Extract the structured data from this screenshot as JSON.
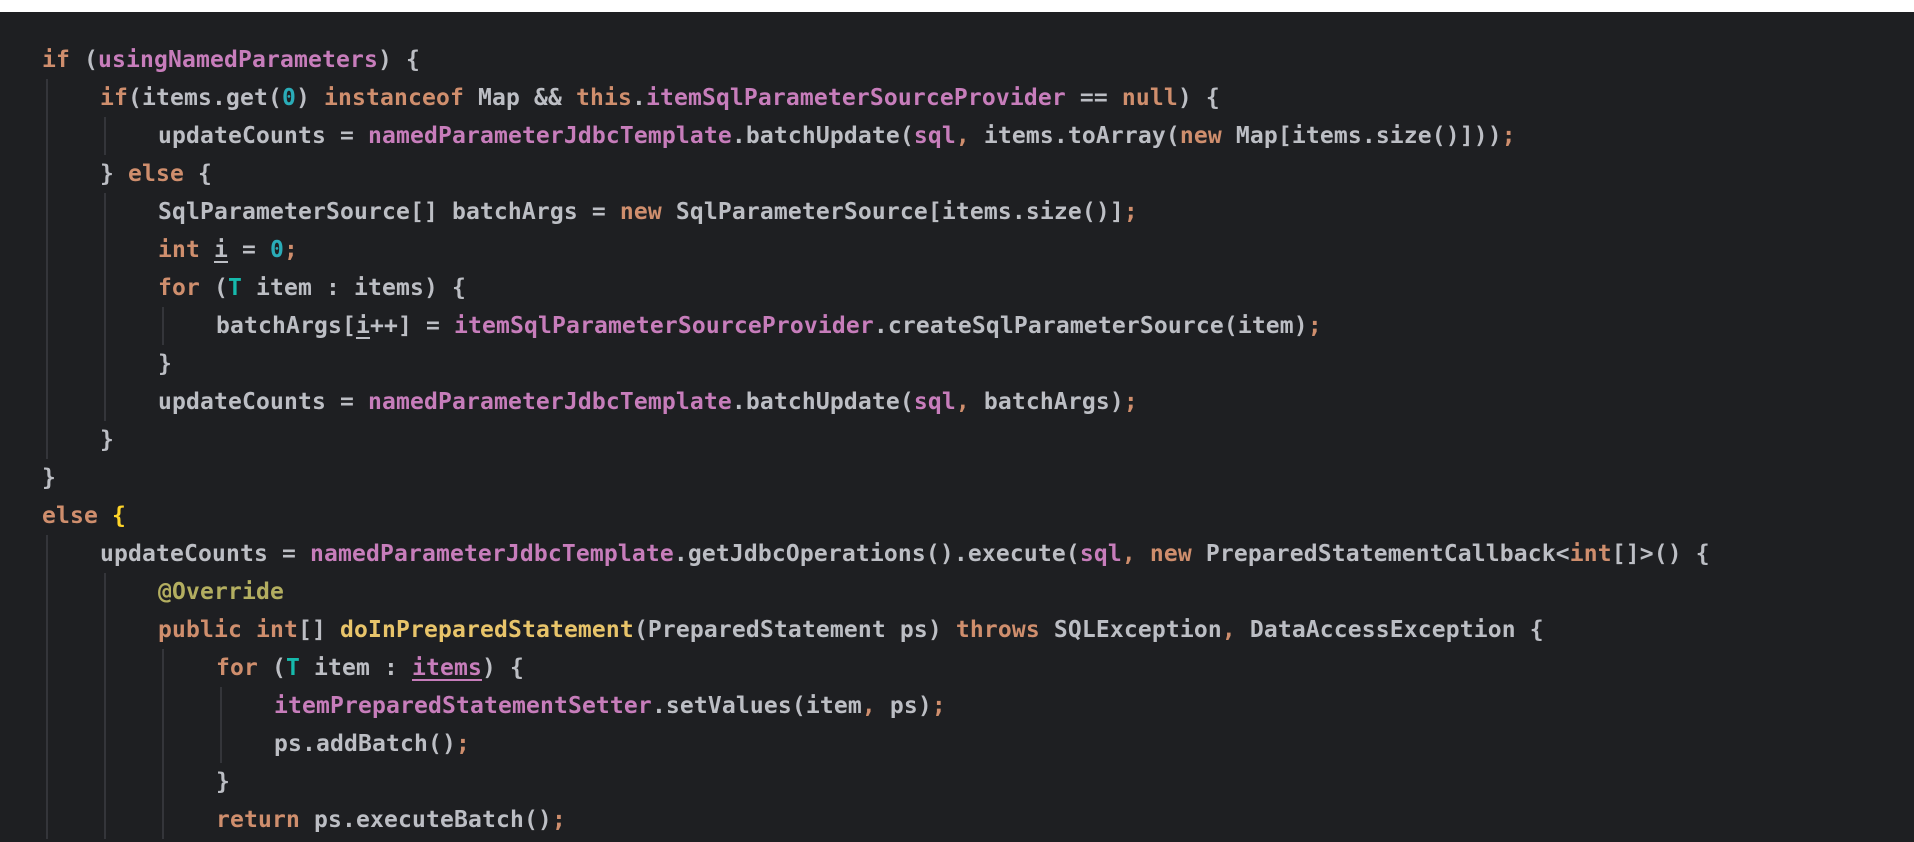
{
  "editor": {
    "theme": {
      "background": "#1e1f22",
      "plain": "#bcbec4",
      "keyword": "#cf8e6d",
      "field": "#c77dbb",
      "number": "#2aacb8",
      "type_param": "#16baac",
      "annotation": "#b3ae60",
      "method_decl": "#e8c46a",
      "brace_match": "#ffd429",
      "indent_guide": "#3b3d42"
    },
    "lines": [
      {
        "indent": 0,
        "tokens": [
          {
            "t": "if",
            "c": "kw"
          },
          {
            "t": " (",
            "c": "pl"
          },
          {
            "t": "usingNamedParameters",
            "c": "fld"
          },
          {
            "t": ") {",
            "c": "pl"
          }
        ]
      },
      {
        "indent": 1,
        "tokens": [
          {
            "t": "if",
            "c": "kw"
          },
          {
            "t": "(items.get(",
            "c": "pl"
          },
          {
            "t": "0",
            "c": "num"
          },
          {
            "t": ") ",
            "c": "pl"
          },
          {
            "t": "instanceof",
            "c": "kw"
          },
          {
            "t": " Map && ",
            "c": "pl"
          },
          {
            "t": "this",
            "c": "kw"
          },
          {
            "t": ".",
            "c": "pl"
          },
          {
            "t": "itemSqlParameterSourceProvider",
            "c": "fld"
          },
          {
            "t": " == ",
            "c": "pl"
          },
          {
            "t": "null",
            "c": "kw"
          },
          {
            "t": ") {",
            "c": "pl"
          }
        ]
      },
      {
        "indent": 2,
        "tokens": [
          {
            "t": "updateCounts = ",
            "c": "pl"
          },
          {
            "t": "namedParameterJdbcTemplate",
            "c": "fld"
          },
          {
            "t": ".batchUpdate(",
            "c": "pl"
          },
          {
            "t": "sql",
            "c": "fld"
          },
          {
            "t": ",",
            "c": "kw"
          },
          {
            "t": " items.toArray(",
            "c": "pl"
          },
          {
            "t": "new",
            "c": "kw"
          },
          {
            "t": " Map[items.size()]))",
            "c": "pl"
          },
          {
            "t": ";",
            "c": "kw"
          }
        ]
      },
      {
        "indent": 1,
        "tokens": [
          {
            "t": "} ",
            "c": "pl"
          },
          {
            "t": "else",
            "c": "kw"
          },
          {
            "t": " {",
            "c": "pl"
          }
        ]
      },
      {
        "indent": 2,
        "tokens": [
          {
            "t": "SqlParameterSource[] batchArgs = ",
            "c": "pl"
          },
          {
            "t": "new",
            "c": "kw"
          },
          {
            "t": " SqlParameterSource[items.size()]",
            "c": "pl"
          },
          {
            "t": ";",
            "c": "kw"
          }
        ]
      },
      {
        "indent": 2,
        "tokens": [
          {
            "t": "int",
            "c": "kw"
          },
          {
            "t": " ",
            "c": "pl"
          },
          {
            "t": "i",
            "c": "pl",
            "u": true
          },
          {
            "t": " = ",
            "c": "pl"
          },
          {
            "t": "0",
            "c": "num"
          },
          {
            "t": ";",
            "c": "kw"
          }
        ]
      },
      {
        "indent": 2,
        "tokens": [
          {
            "t": "for",
            "c": "kw"
          },
          {
            "t": " (",
            "c": "pl"
          },
          {
            "t": "T",
            "c": "tp"
          },
          {
            "t": " item : items) {",
            "c": "pl"
          }
        ]
      },
      {
        "indent": 3,
        "tokens": [
          {
            "t": "batchArgs[",
            "c": "pl"
          },
          {
            "t": "i",
            "c": "pl",
            "u": true
          },
          {
            "t": "++] = ",
            "c": "pl"
          },
          {
            "t": "itemSqlParameterSourceProvider",
            "c": "fld"
          },
          {
            "t": ".createSqlParameterSource(item)",
            "c": "pl"
          },
          {
            "t": ";",
            "c": "kw"
          }
        ]
      },
      {
        "indent": 2,
        "tokens": [
          {
            "t": "}",
            "c": "pl"
          }
        ]
      },
      {
        "indent": 2,
        "tokens": [
          {
            "t": "updateCounts = ",
            "c": "pl"
          },
          {
            "t": "namedParameterJdbcTemplate",
            "c": "fld"
          },
          {
            "t": ".batchUpdate(",
            "c": "pl"
          },
          {
            "t": "sql",
            "c": "fld"
          },
          {
            "t": ",",
            "c": "kw"
          },
          {
            "t": " batchArgs)",
            "c": "pl"
          },
          {
            "t": ";",
            "c": "kw"
          }
        ]
      },
      {
        "indent": 1,
        "tokens": [
          {
            "t": "}",
            "c": "pl"
          }
        ]
      },
      {
        "indent": 0,
        "tokens": [
          {
            "t": "}",
            "c": "pl"
          }
        ]
      },
      {
        "indent": 0,
        "tokens": [
          {
            "t": "else",
            "c": "kw"
          },
          {
            "t": " ",
            "c": "pl"
          },
          {
            "t": "{",
            "c": "br"
          }
        ]
      },
      {
        "indent": 1,
        "tokens": [
          {
            "t": "updateCounts = ",
            "c": "pl"
          },
          {
            "t": "namedParameterJdbcTemplate",
            "c": "fld"
          },
          {
            "t": ".getJdbcOperations().execute(",
            "c": "pl"
          },
          {
            "t": "sql",
            "c": "fld"
          },
          {
            "t": ",",
            "c": "kw"
          },
          {
            "t": " ",
            "c": "pl"
          },
          {
            "t": "new",
            "c": "kw"
          },
          {
            "t": " PreparedStatementCallback<",
            "c": "pl"
          },
          {
            "t": "int",
            "c": "kw"
          },
          {
            "t": "[]>() {",
            "c": "pl"
          }
        ]
      },
      {
        "indent": 2,
        "tokens": [
          {
            "t": "@Override",
            "c": "ann"
          }
        ]
      },
      {
        "indent": 2,
        "tokens": [
          {
            "t": "public",
            "c": "kw"
          },
          {
            "t": " ",
            "c": "pl"
          },
          {
            "t": "int",
            "c": "kw"
          },
          {
            "t": "[] ",
            "c": "pl"
          },
          {
            "t": "doInPreparedStatement",
            "c": "mdecl"
          },
          {
            "t": "(PreparedStatement ps) ",
            "c": "pl"
          },
          {
            "t": "throws",
            "c": "kw"
          },
          {
            "t": " SQLException",
            "c": "pl"
          },
          {
            "t": ",",
            "c": "kw"
          },
          {
            "t": " DataAccessException {",
            "c": "pl"
          }
        ]
      },
      {
        "indent": 3,
        "tokens": [
          {
            "t": "for",
            "c": "kw"
          },
          {
            "t": " (",
            "c": "pl"
          },
          {
            "t": "T",
            "c": "tp"
          },
          {
            "t": " item : ",
            "c": "pl"
          },
          {
            "t": "items",
            "c": "fld",
            "u": true
          },
          {
            "t": ") {",
            "c": "pl"
          }
        ]
      },
      {
        "indent": 4,
        "tokens": [
          {
            "t": "itemPreparedStatementSetter",
            "c": "fld"
          },
          {
            "t": ".setValues(item",
            "c": "pl"
          },
          {
            "t": ",",
            "c": "kw"
          },
          {
            "t": " ps)",
            "c": "pl"
          },
          {
            "t": ";",
            "c": "kw"
          }
        ]
      },
      {
        "indent": 4,
        "tokens": [
          {
            "t": "ps.addBatch()",
            "c": "pl"
          },
          {
            "t": ";",
            "c": "kw"
          }
        ]
      },
      {
        "indent": 3,
        "tokens": [
          {
            "t": "}",
            "c": "pl"
          }
        ]
      },
      {
        "indent": 3,
        "tokens": [
          {
            "t": "return",
            "c": "kw"
          },
          {
            "t": " ps.executeBatch()",
            "c": "pl"
          },
          {
            "t": ";",
            "c": "kw"
          }
        ]
      }
    ]
  }
}
